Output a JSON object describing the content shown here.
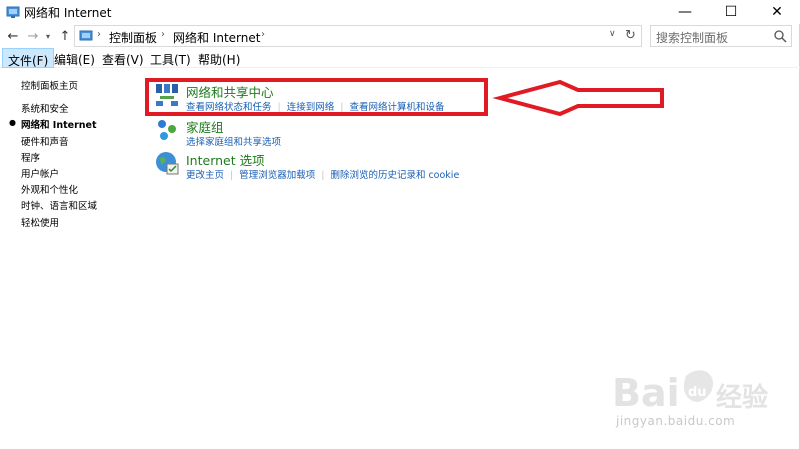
{
  "window": {
    "title": "网络和 Internet",
    "controls": {
      "minimize": "—",
      "maximize": "☐",
      "close": "✕"
    }
  },
  "address": {
    "breadcrumbs": [
      "控制面板",
      "网络和 Internet"
    ],
    "search_placeholder": "搜索控制面板"
  },
  "menu": {
    "items": [
      {
        "label": "文件(F)",
        "active": true
      },
      {
        "label": "编辑(E)"
      },
      {
        "label": "查看(V)"
      },
      {
        "label": "工具(T)"
      },
      {
        "label": "帮助(H)"
      }
    ]
  },
  "sidebar": {
    "items": [
      {
        "label": "控制面板主页"
      },
      {
        "label": "系统和安全"
      },
      {
        "label": "网络和 Internet",
        "current": true
      },
      {
        "label": "硬件和声音"
      },
      {
        "label": "程序"
      },
      {
        "label": "用户帐户"
      },
      {
        "label": "外观和个性化"
      },
      {
        "label": "时钟、语言和区域"
      },
      {
        "label": "轻松使用"
      }
    ]
  },
  "categories": [
    {
      "title": "网络和共享中心",
      "icon": "network-sharing-icon",
      "links": [
        "查看网络状态和任务",
        "连接到网络",
        "查看网络计算机和设备"
      ]
    },
    {
      "title": "家庭组",
      "icon": "homegroup-icon",
      "links": [
        "选择家庭组和共享选项"
      ]
    },
    {
      "title": "Internet 选项",
      "icon": "internet-options-icon",
      "links": [
        "更改主页",
        "管理浏览器加载项",
        "删除浏览的历史记录和 cookie"
      ]
    }
  ],
  "watermark": {
    "brand": "Bai",
    "brand2": "经验",
    "url": "jingyan.baidu.com"
  },
  "colors": {
    "category_title": "#1e7b1e",
    "link": "#1a5fb4",
    "annotation": "#e01b24",
    "menu_active_bg": "#cce8ff"
  }
}
